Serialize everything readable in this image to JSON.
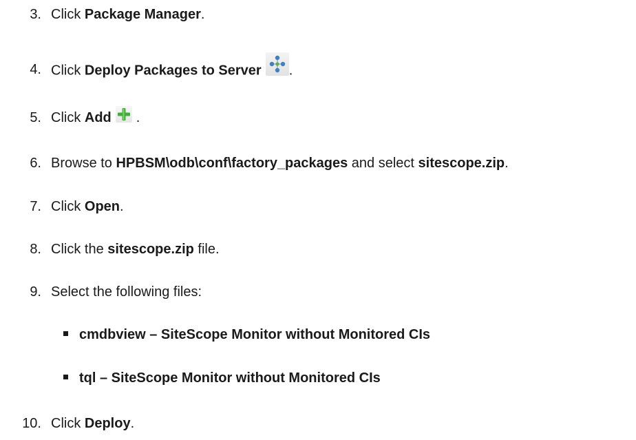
{
  "steps": [
    {
      "num": "3.",
      "pre": "Click ",
      "bold": "Package Manager",
      "post": "."
    },
    {
      "num": "4.",
      "pre": "Click ",
      "bold": "Deploy Packages to Server",
      "post": "."
    },
    {
      "num": "5.",
      "pre": "Click ",
      "bold": "Add",
      "post": "."
    },
    {
      "num": "6.",
      "pre": "Browse to ",
      "bold": "HPBSM\\odb\\conf\\factory_packages",
      "mid": " and select ",
      "bold2": "sitescope.zip",
      "post": "."
    },
    {
      "num": "7.",
      "pre": "Click ",
      "bold": "Open",
      "post": "."
    },
    {
      "num": "8.",
      "pre": "Click the ",
      "bold": "sitescope.zip",
      "post": " file."
    },
    {
      "num": "9.",
      "pre": "Select the following files:"
    },
    {
      "num": "10.",
      "pre": "Click ",
      "bold": "Deploy",
      "post": "."
    }
  ],
  "bullets": [
    "cmdbview – SiteScope Monitor without Monitored CIs",
    "tql – SiteScope Monitor without Monitored CIs"
  ],
  "icons": {
    "deploy": "deploy-packages-icon",
    "add": "add-icon"
  },
  "colors": {
    "text": "#1a1a1a",
    "add_green": "#3fae3a",
    "deploy_blue": "#3f7fc4"
  }
}
